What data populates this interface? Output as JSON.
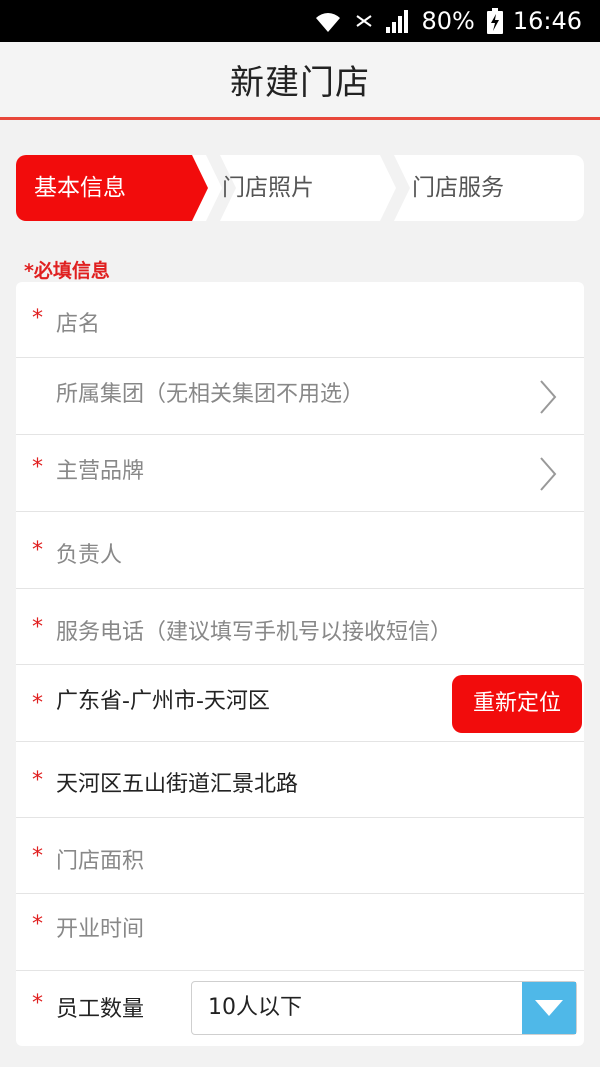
{
  "status_bar": {
    "battery": "80%",
    "time": "16:46"
  },
  "header": {
    "title": "新建门店"
  },
  "steps": [
    {
      "label": "基本信息",
      "active": true
    },
    {
      "label": "门店照片",
      "active": false
    },
    {
      "label": "门店服务",
      "active": false
    }
  ],
  "required_note": "*必填信息",
  "form": {
    "required_mark": "*",
    "store_name": {
      "placeholder": "店名"
    },
    "group": {
      "placeholder": "所属集团（无相关集团不用选）"
    },
    "brand": {
      "placeholder": "主营品牌"
    },
    "manager": {
      "placeholder": "负责人"
    },
    "phone": {
      "placeholder": "服务电话（建议填写手机号以接收短信）"
    },
    "region": {
      "value": "广东省-广州市-天河区",
      "button": "重新定位"
    },
    "address": {
      "value": "天河区五山街道汇景北路"
    },
    "area": {
      "placeholder": "门店面积"
    },
    "open_time": {
      "placeholder": "开业时间"
    },
    "staff": {
      "label": "员工数量",
      "selected": "10人以下"
    }
  },
  "colors": {
    "accent": "#f20c0c",
    "header_line": "#e8473a",
    "select_button": "#4fb8e8"
  }
}
